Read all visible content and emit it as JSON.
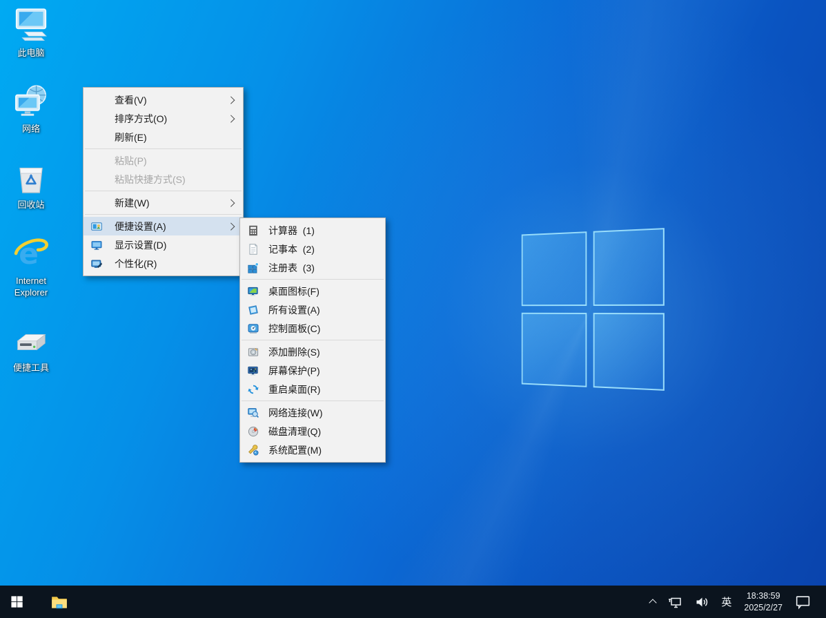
{
  "colors": {
    "wallpaper_bottom_left": "#00aaf2",
    "wallpaper_top_right": "#0a44ad",
    "taskbar_bg": "#0b141e",
    "menu_bg": "#f2f2f2",
    "menu_highlight": "#d4e1ef",
    "menu_text": "#1b1b1b",
    "menu_disabled_text": "#a6a6a6",
    "desktop_label_text": "#ffffff"
  },
  "desktop": {
    "icons": [
      {
        "id": "this-pc",
        "label": "此电脑"
      },
      {
        "id": "network",
        "label": "网络"
      },
      {
        "id": "recycle-bin",
        "label": "回收站"
      },
      {
        "id": "internet-explorer",
        "label": "Internet Explorer"
      },
      {
        "id": "portable-tools",
        "label": "便捷工具"
      }
    ]
  },
  "context_menu": {
    "items": [
      {
        "id": "view",
        "label": "查看(V)",
        "submenu": true
      },
      {
        "id": "sort-by",
        "label": "排序方式(O)",
        "submenu": true
      },
      {
        "id": "refresh",
        "label": "刷新(E)"
      },
      {
        "type": "separator"
      },
      {
        "id": "paste",
        "label": "粘贴(P)",
        "disabled": true
      },
      {
        "id": "paste-shortcut",
        "label": "粘贴快捷方式(S)",
        "disabled": true
      },
      {
        "type": "separator"
      },
      {
        "id": "new",
        "label": "新建(W)",
        "submenu": true
      },
      {
        "type": "separator"
      },
      {
        "id": "quick-settings",
        "label": "便捷设置(A)",
        "icon": "quick-settings",
        "submenu": true,
        "selected": true
      },
      {
        "id": "display-settings",
        "label": "显示设置(D)",
        "icon": "display-settings"
      },
      {
        "id": "personalize",
        "label": "个性化(R)",
        "icon": "personalize"
      }
    ]
  },
  "quick_settings_submenu": {
    "items": [
      {
        "id": "calculator",
        "label": "计算器  (1)",
        "icon": "calculator"
      },
      {
        "id": "notepad",
        "label": "记事本  (2)",
        "icon": "notepad"
      },
      {
        "id": "registry",
        "label": "注册表  (3)",
        "icon": "registry"
      },
      {
        "type": "separator"
      },
      {
        "id": "desktop-icons-cfg",
        "label": "桌面图标(F)",
        "icon": "desktop-icons-cfg"
      },
      {
        "id": "all-settings",
        "label": "所有设置(A)",
        "icon": "all-settings"
      },
      {
        "id": "control-panel",
        "label": "控制面板(C)",
        "icon": "control-panel"
      },
      {
        "type": "separator"
      },
      {
        "id": "add-remove",
        "label": "添加删除(S)",
        "icon": "add-remove"
      },
      {
        "id": "screen-saver",
        "label": "屏幕保护(P)",
        "icon": "screen-saver"
      },
      {
        "id": "restart-desktop",
        "label": "重启桌面(R)",
        "icon": "restart-desktop"
      },
      {
        "type": "separator"
      },
      {
        "id": "network-connections",
        "label": "网络连接(W)",
        "icon": "network-connections"
      },
      {
        "id": "disk-cleanup",
        "label": "磁盘清理(Q)",
        "icon": "disk-cleanup"
      },
      {
        "id": "system-config",
        "label": "系统配置(M)",
        "icon": "system-config"
      }
    ]
  },
  "taskbar": {
    "apps": [
      {
        "id": "file-explorer"
      }
    ],
    "tray": {
      "icon_names": [
        "hidden-icons-chevron",
        "network-icon",
        "volume-icon",
        "action-center-icon"
      ],
      "language": "英",
      "time": "18:38:59",
      "date": "2025/2/27"
    }
  }
}
